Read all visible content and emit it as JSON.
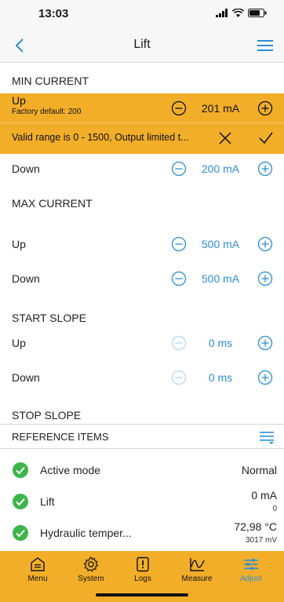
{
  "status_bar": {
    "time": "13:03"
  },
  "header": {
    "title": "Lift"
  },
  "sections": {
    "min_current": {
      "title": "MIN CURRENT",
      "up": {
        "label": "Up",
        "factory_default": "Factory default: 200",
        "value": "201 mA",
        "validation_message": "Valid range is 0 - 1500, Output limited t..."
      },
      "down": {
        "label": "Down",
        "value": "200 mA"
      }
    },
    "max_current": {
      "title": "MAX CURRENT",
      "up": {
        "label": "Up",
        "value": "500 mA"
      },
      "down": {
        "label": "Down",
        "value": "500 mA"
      }
    },
    "start_slope": {
      "title": "START SLOPE",
      "up": {
        "label": "Up",
        "value": "0 ms"
      },
      "down": {
        "label": "Down",
        "value": "0 ms"
      }
    },
    "stop_slope": {
      "title": "STOP SLOPE"
    }
  },
  "reference_items": {
    "title": "REFERENCE ITEMS",
    "items": [
      {
        "label": "Active mode",
        "value": "Normal",
        "sub": ""
      },
      {
        "label": "Lift",
        "value": "0 mA",
        "sub": "0"
      },
      {
        "label": "Hydraulic temper...",
        "value": "72,98 °C",
        "sub": "3017 mV"
      }
    ]
  },
  "tab_bar": {
    "tabs": [
      {
        "label": "Menu",
        "icon": "menu-icon"
      },
      {
        "label": "System",
        "icon": "gear-icon"
      },
      {
        "label": "Logs",
        "icon": "logs-icon"
      },
      {
        "label": "Measure",
        "icon": "measure-icon"
      },
      {
        "label": "Adjust",
        "icon": "sliders-icon",
        "active": true
      }
    ]
  },
  "colors": {
    "accent": "#2c8fd6",
    "highlight": "#f2ae29",
    "check": "#3cb54a"
  }
}
